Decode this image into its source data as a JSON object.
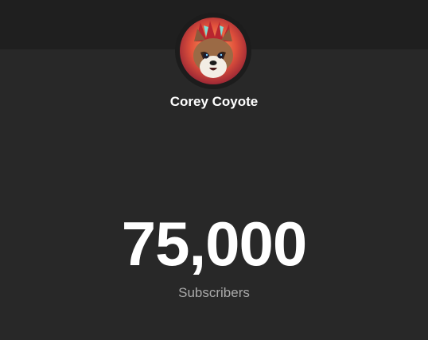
{
  "channel": {
    "name": "Corey Coyote",
    "avatar_icon": "coyote-avatar"
  },
  "stats": {
    "subscriber_count": "75,000",
    "subscriber_label": "Subscribers"
  },
  "colors": {
    "background": "#282828",
    "top_band": "#1f1f1f",
    "primary_text": "#ffffff",
    "secondary_text": "#aaaaaa"
  }
}
